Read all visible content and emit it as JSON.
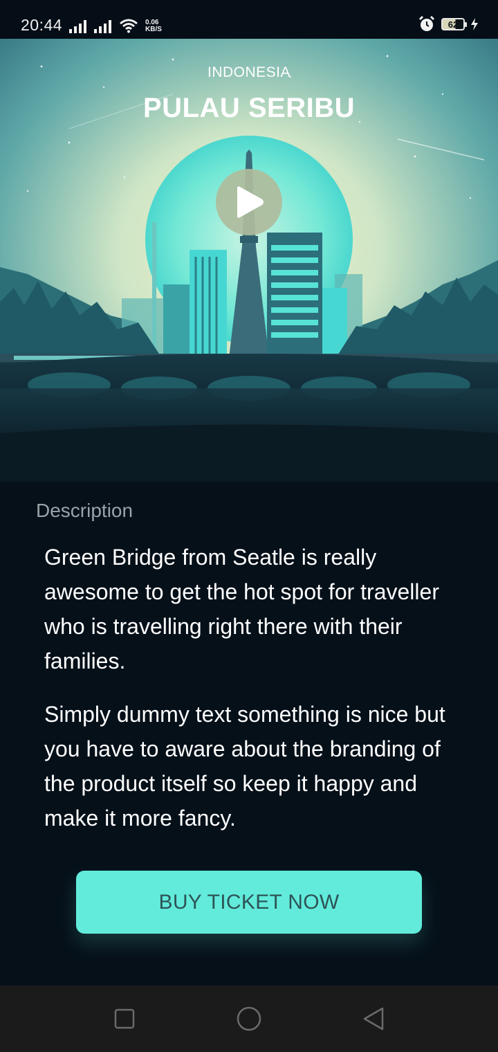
{
  "status_bar": {
    "time": "20:44",
    "net_speed_value": "0.06",
    "net_speed_unit": "KB/S",
    "battery_level": "62"
  },
  "hero": {
    "country": "INDONESIA",
    "title": "PULAU SERIBU",
    "play_icon": "play-icon"
  },
  "description": {
    "label": "Description",
    "paragraphs": [
      "Green Bridge from Seatle is really awesome to get the hot spot for traveller who is travelling right there with their families.",
      "Simply dummy text something is nice but you have to aware about the branding of the product itself so keep it happy and make it more fancy."
    ]
  },
  "cta": {
    "label": "BUY TICKET NOW"
  },
  "nav_bar": {
    "icons": [
      "recents-icon",
      "home-icon",
      "back-icon"
    ]
  },
  "colors": {
    "accent": "#62ebdb",
    "background": "#061019",
    "button_text": "#2d5456"
  }
}
